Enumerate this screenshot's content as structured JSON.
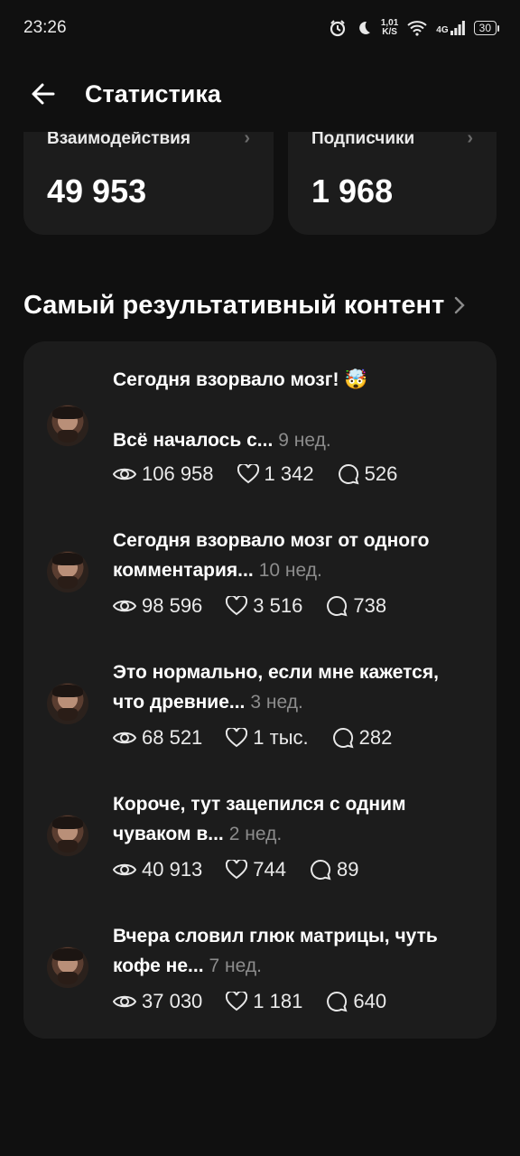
{
  "status_bar": {
    "time": "23:26",
    "net_speed_value": "1,01",
    "net_speed_unit": "K/S",
    "network": "4G",
    "battery": "30"
  },
  "header": {
    "title": "Статистика"
  },
  "cards": [
    {
      "label": "Взаимодействия",
      "value": "49 953"
    },
    {
      "label": "Подписчики",
      "value": "1 968"
    }
  ],
  "section": {
    "title": "Самый результативный контент"
  },
  "posts": [
    {
      "line1": "Сегодня взорвало мозг! 🤯",
      "line2": "Всё началось с...",
      "time": "9 нед.",
      "views": "106 958",
      "likes": "1 342",
      "comments": "526"
    },
    {
      "line1": "Сегодня взорвало мозг от одного",
      "line2": "комментария...",
      "time": "10 нед.",
      "views": "98 596",
      "likes": "3 516",
      "comments": "738"
    },
    {
      "line1": "Это нормально, если мне кажется,",
      "line2": "что древние...",
      "time": "3 нед.",
      "views": "68 521",
      "likes": "1 тыс.",
      "comments": "282"
    },
    {
      "line1": "Короче, тут зацепился с одним",
      "line2": "чуваком в...",
      "time": "2 нед.",
      "views": "40 913",
      "likes": "744",
      "comments": "89"
    },
    {
      "line1": "Вчера словил глюк матрицы, чуть",
      "line2": "кофе не...",
      "time": "7 нед.",
      "views": "37 030",
      "likes": "1 181",
      "comments": "640"
    }
  ],
  "icons": {
    "back": "arrow-left-icon",
    "chevron": "chevron-right-icon",
    "views": "eye-icon",
    "likes": "heart-icon",
    "comments": "comment-icon"
  }
}
